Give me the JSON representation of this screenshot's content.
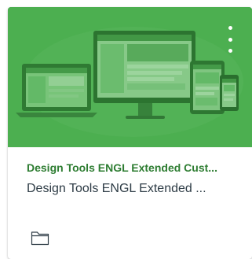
{
  "card": {
    "title": "Design Tools ENGL Extended Cust...",
    "subtitle": "Design Tools ENGL Extended ...",
    "accent_color": "#2e7d32",
    "hero_color": "#4caf50",
    "hero_image": "devices-illustration",
    "menu_icon": "kebab-menu-icon",
    "footer_icon": "folder-icon"
  }
}
